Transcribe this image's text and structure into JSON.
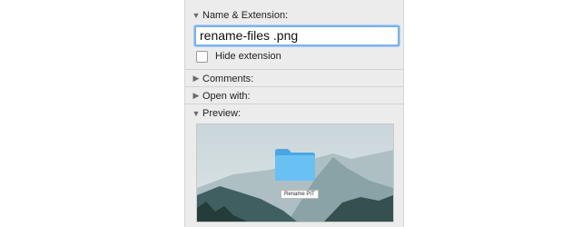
{
  "sections": {
    "name_extension": {
      "title": "Name & Extension:",
      "expanded": true
    },
    "comments": {
      "title": "Comments:",
      "expanded": false
    },
    "open_with": {
      "title": "Open with:",
      "expanded": false
    },
    "preview": {
      "title": "Preview:",
      "expanded": true
    }
  },
  "name_field": {
    "value": "rename-files .png"
  },
  "hide_extension": {
    "label": "Hide extension",
    "checked": false
  },
  "preview_image": {
    "file_label": "Rename PIT",
    "folder_icon": "folder-icon"
  },
  "colors": {
    "panel_bg": "#ececec",
    "focus_ring": "#7cb2ee",
    "folder_blue": "#5fb6ef"
  }
}
